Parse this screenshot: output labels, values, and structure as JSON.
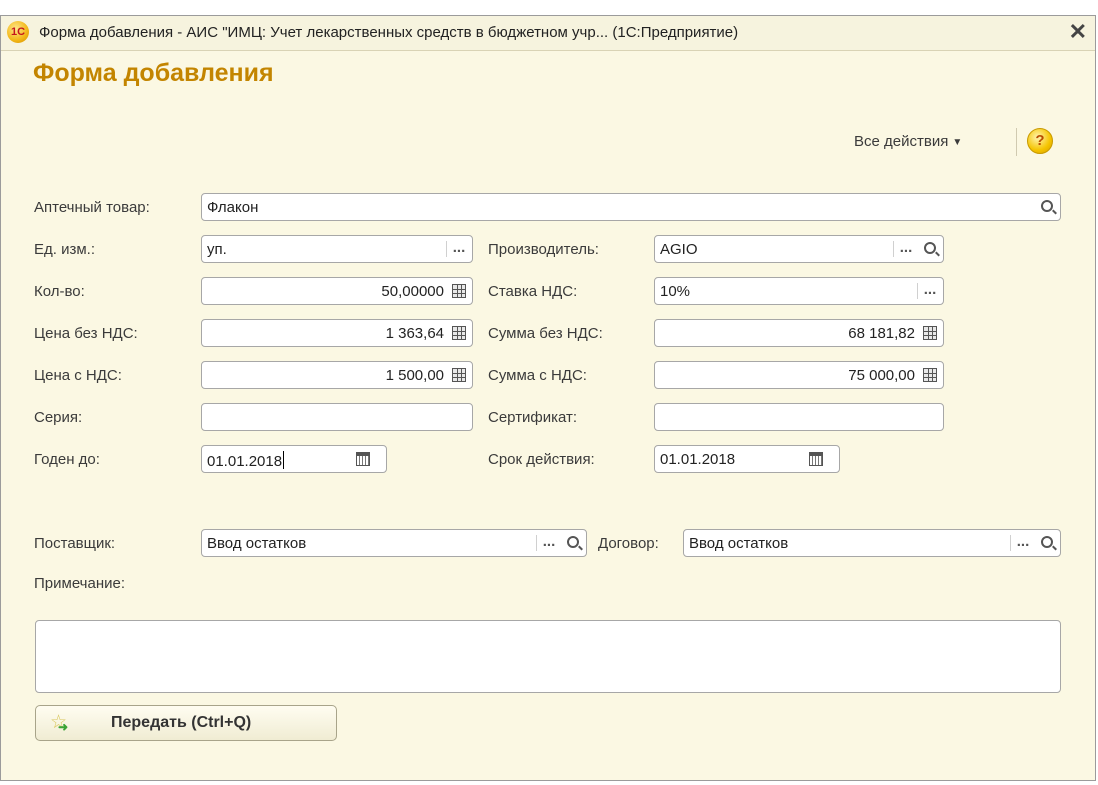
{
  "window": {
    "title": "Форма добавления - АИС \"ИМЦ: Учет лекарственных средств в бюджетном учр...  (1С:Предприятие)",
    "app_icon_text": "1С"
  },
  "form": {
    "heading": "Форма добавления",
    "all_actions_label": "Все действия",
    "help_label": "?"
  },
  "fields": {
    "product": {
      "label": "Аптечный товар:",
      "value": "Флакон"
    },
    "unit": {
      "label": "Ед. изм.:",
      "value": "уп."
    },
    "manufacturer": {
      "label": "Производитель:",
      "value": "AGIO"
    },
    "quantity": {
      "label": "Кол-во:",
      "value": "50,00000"
    },
    "vat_rate": {
      "label": "Ставка НДС:",
      "value": "10%"
    },
    "price_no_vat": {
      "label": "Цена без НДС:",
      "value": "1 363,64"
    },
    "sum_no_vat": {
      "label": "Сумма без НДС:",
      "value": "68 181,82"
    },
    "price_vat": {
      "label": "Цена с НДС:",
      "value": "1 500,00"
    },
    "sum_vat": {
      "label": "Сумма с НДС:",
      "value": "75 000,00"
    },
    "series": {
      "label": "Серия:",
      "value": ""
    },
    "certificate": {
      "label": "Сертификат:",
      "value": ""
    },
    "expiry": {
      "label": "Годен до:",
      "value": "01.01.2018"
    },
    "validity": {
      "label": "Срок действия:",
      "value": "01.01.2018"
    },
    "supplier": {
      "label": "Поставщик:",
      "value": "Ввод остатков"
    },
    "contract": {
      "label": "Договор:",
      "value": "Ввод остатков"
    },
    "note": {
      "label": "Примечание:",
      "value": ""
    }
  },
  "buttons": {
    "send_label": "Передать (Ctrl+Q)",
    "dots": "..."
  },
  "colors": {
    "accent": "#c38500",
    "form_bg": "#fbf8e3"
  }
}
